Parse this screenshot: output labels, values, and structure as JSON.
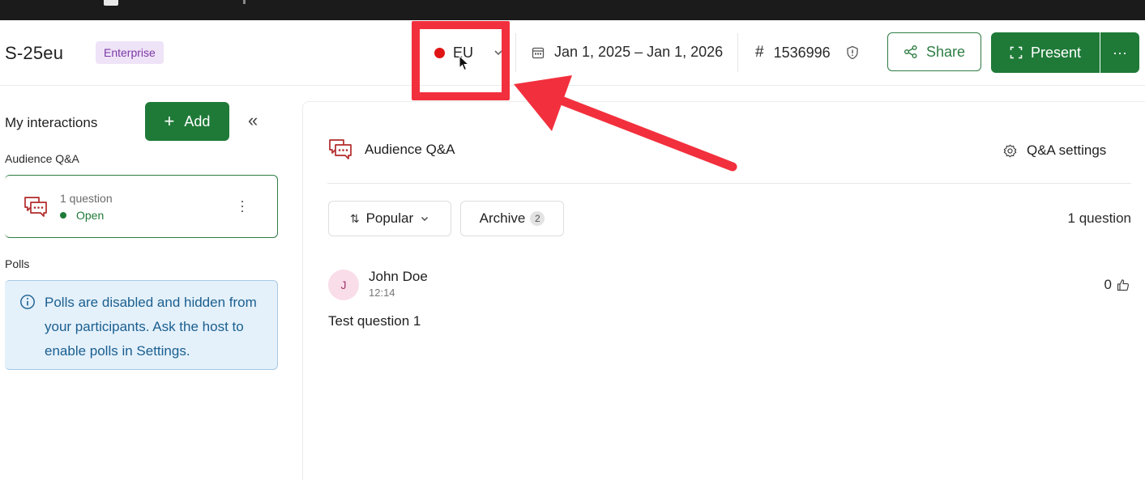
{
  "header": {
    "event_title": "S-25eu",
    "plan_badge": "Enterprise",
    "region": {
      "label": "EU",
      "live_color": "#e01414"
    },
    "date_range": "Jan 1, 2025 – Jan 1, 2026",
    "event_code_hash": "#",
    "event_code": "1536996",
    "share_label": "Share",
    "present_label": "Present",
    "more_label": "···"
  },
  "sidebar": {
    "title": "My interactions",
    "add_label": "Add",
    "collapse_glyph": "«",
    "qa_section": "Audience Q&A",
    "qa_card": {
      "count_text": "1 question",
      "status": "Open"
    },
    "polls_section": "Polls",
    "polls_notice": "Polls are disabled and hidden from your participants. Ask the host to enable polls in Settings."
  },
  "main": {
    "title": "Audience Q&A",
    "settings_label": "Q&A settings",
    "sort_label": "Popular",
    "archive_label": "Archive",
    "archive_count": "2",
    "question_count": "1 question",
    "question": {
      "avatar_initial": "J",
      "author": "John Doe",
      "time": "12:14",
      "likes": "0",
      "text": "Test question 1"
    }
  },
  "colors": {
    "primary_green": "#1f7a38",
    "annotation_red": "#f2303d",
    "info_blue_bg": "#e4f1fb",
    "badge_purple_bg": "#efe3f7"
  },
  "icons": [
    "calendar-icon",
    "shield-info-icon",
    "share-icon",
    "present-icon",
    "chat-icon",
    "gear-icon",
    "info-icon",
    "sort-icon",
    "chevron-down-icon",
    "thumbs-up-icon",
    "cursor-icon"
  ]
}
